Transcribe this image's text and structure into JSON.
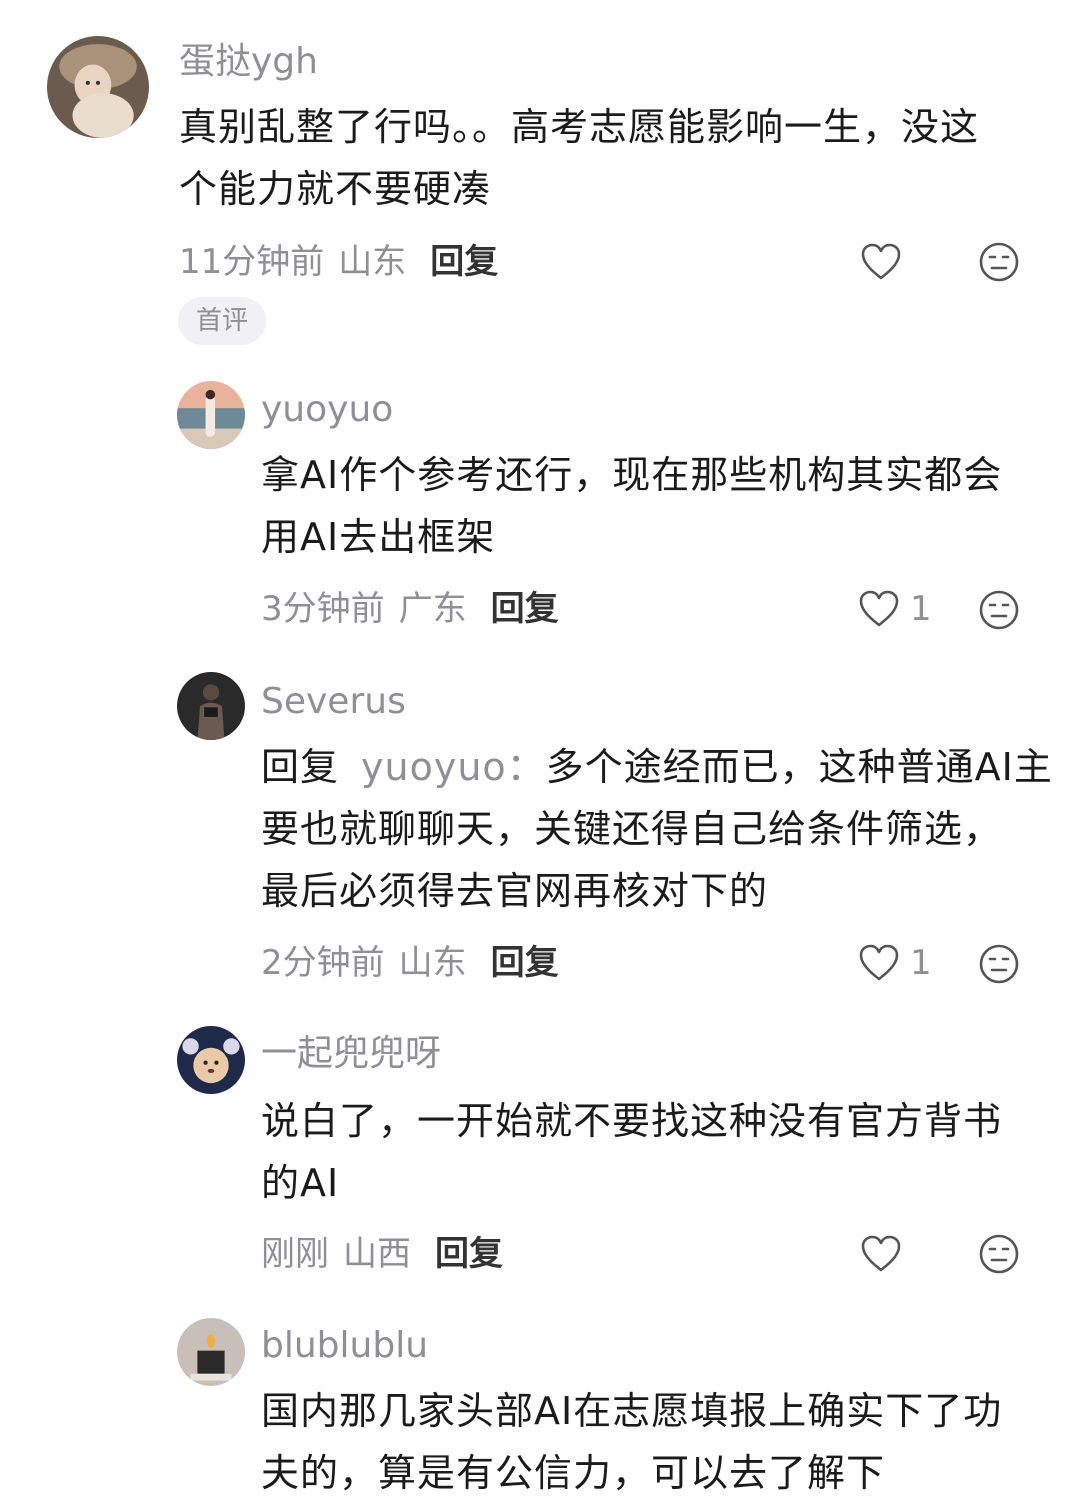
{
  "comments": [
    {
      "username": "蛋挞ygh",
      "content": "真别乱整了行吗。。高考志愿能影响一生，没这个能力就不要硬凑",
      "lines": [
        "真别乱整了行吗。。高考志愿能影响一生，没这",
        "个能力就不要硬凑"
      ],
      "time": "11分钟前",
      "location": "山东",
      "reply_label": "回复",
      "likes": "",
      "badge": "首评",
      "avatar_icon": "avatar-woman-with-cat"
    },
    {
      "username": "yuoyuo",
      "lines": [
        "拿AI作个参考还行，现在那些机构其实都会",
        "用AI去出框架"
      ],
      "time": "3分钟前",
      "location": "广东",
      "reply_label": "回复",
      "likes": "1",
      "avatar_icon": "avatar-beach-girl"
    },
    {
      "username": "Severus",
      "reply_prefix": "回复",
      "reply_target": "yuoyuo：",
      "lines": [
        "多个途经而已，这种普通AI主",
        "要也就聊聊天，关键还得自己给条件筛选，",
        "最后必须得去官网再核对下的"
      ],
      "time": "2分钟前",
      "location": "山东",
      "reply_label": "回复",
      "likes": "1",
      "avatar_icon": "avatar-athlete"
    },
    {
      "username": "一起兜兜呀",
      "lines": [
        "说白了，一开始就不要找这种没有官方背书",
        "的AI"
      ],
      "time": "刚刚",
      "location": "山西",
      "reply_label": "回复",
      "likes": "",
      "avatar_icon": "avatar-toy-dog"
    },
    {
      "username": "blublublu",
      "lines": [
        "国内那几家头部AI在志愿填报上确实下了功",
        "夫的，算是有公信力，可以去了解下"
      ],
      "avatar_icon": "avatar-candle"
    }
  ],
  "colors": {
    "text": "#1b1b1b",
    "muted": "#8f8f94",
    "badge_bg": "#f1f1f3"
  }
}
